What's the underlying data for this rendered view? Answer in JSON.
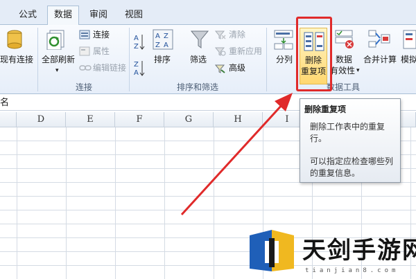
{
  "tabs": [
    {
      "label": "公式",
      "active": false
    },
    {
      "label": "数据",
      "active": true
    },
    {
      "label": "审阅",
      "active": false
    },
    {
      "label": "视图",
      "active": false
    }
  ],
  "ribbon": {
    "existing_connections": "现有连接",
    "refresh_all": "全部刷新",
    "connections": "连接",
    "properties": "属性",
    "edit_links": "编辑链接",
    "group_connections": "连接",
    "sort": "排序",
    "filter": "筛选",
    "clear": "清除",
    "reapply": "重新应用",
    "advanced": "高级",
    "group_sort_filter": "排序和筛选",
    "text_to_columns": "分列",
    "remove_dup_line1": "删除",
    "remove_dup_line2": "重复项",
    "data_validation_line1": "数据",
    "data_validation_line2": "有效性",
    "consolidate": "合并计算",
    "whatif": "模拟",
    "group_data_tools": "数据工具"
  },
  "namebox": {
    "value": "名"
  },
  "columns": [
    "D",
    "E",
    "F",
    "G",
    "H",
    "I"
  ],
  "tooltip": {
    "title": "删除重复项",
    "desc_line1": "删除工作表中的重复",
    "desc_line2": "行。",
    "hint_line1": "可以指定应检查哪些列",
    "hint_line2": "的重复信息。"
  },
  "watermark": {
    "text": "天剑手游网",
    "sub": "tianjian8.com"
  },
  "colors": {
    "accent_red": "#e02a2a",
    "highlight": "#ffd770"
  }
}
